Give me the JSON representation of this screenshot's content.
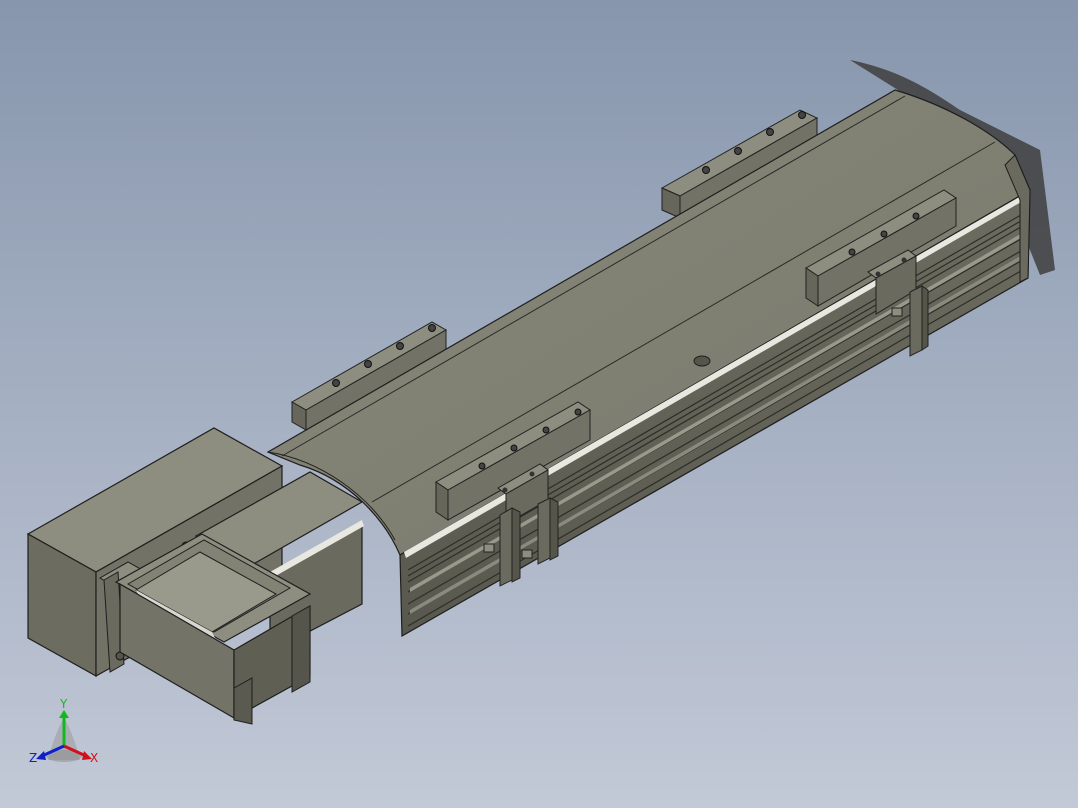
{
  "viewport": {
    "background_top": "#8796ad",
    "background_bottom": "#c2c9d7"
  },
  "model": {
    "body_color": "#7b7b6d",
    "shade_color": "#5d5d52",
    "light_color": "#9a9a8c"
  },
  "triad": {
    "x_label": "X",
    "y_label": "Y",
    "z_label": "Z",
    "x_color": "#d0101c",
    "y_color": "#12b81e",
    "z_color": "#1020c8"
  }
}
